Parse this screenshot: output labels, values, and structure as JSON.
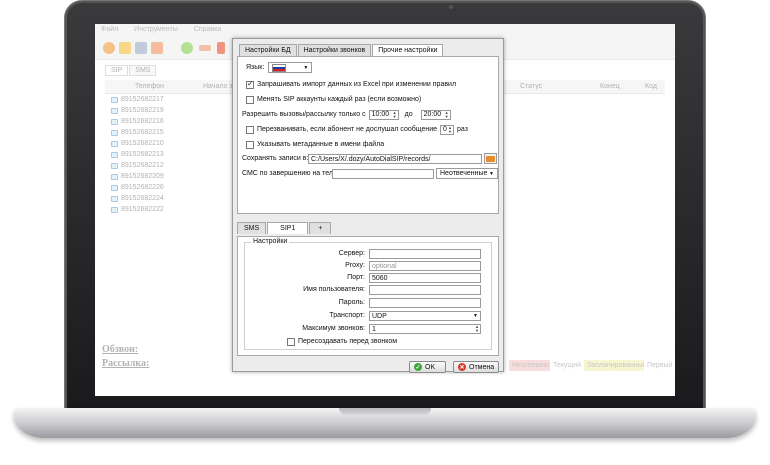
{
  "menu": [
    "Файл",
    "Инструменты",
    "Справка"
  ],
  "main": {
    "tabs": [
      "SIP",
      "SMS"
    ],
    "columns": [
      "Телефон",
      "Начало з",
      "Статус",
      "Конец",
      "Код"
    ],
    "phones": [
      "89152682217",
      "89152682219",
      "89152682216",
      "89152682215",
      "89152682210",
      "89152682213",
      "89152682212",
      "89152682209",
      "89152682226",
      "89152682224",
      "89152682222"
    ],
    "obzvon": "Обзвон:",
    "rassylka": "Рассылка:",
    "legend": [
      {
        "label": "Неуспешно",
        "color": "#f6c9c9"
      },
      {
        "label": "Текущий",
        "color": "#ffffff"
      },
      {
        "label": "Запланированный",
        "color": "#f4f1b8"
      },
      {
        "label": "Первый",
        "color": "#ffffff"
      }
    ]
  },
  "dialog": {
    "tabs": [
      "Настройки БД",
      "Настройки звонков",
      "Прочие настройки"
    ],
    "language_label": "Язык:",
    "import_excel": "Запрашивать импорт данных из Excel при изменении правил",
    "import_excel_checked": true,
    "change_sip": "Менять SIP аккаунты каждый раз (если возможно)",
    "change_sip_checked": false,
    "allow_calls_label": "Разрешить вызовы/рассылку только с",
    "time_from": "10:00",
    "time_to_label": "до",
    "time_to": "20:00",
    "recall_label": "Перезванивать, если абонент не дослушал сообщение",
    "recall_count": "0",
    "recall_suffix": "раз",
    "metadata_label": "Указывать метаданные в имени файла",
    "save_records_label": "Сохранять записи в:",
    "save_records_path": "C:/Users/X/.dozy/AutoDialSIP/records/",
    "sms_label": "СМС по завершению на тел:",
    "sms_value": "",
    "sms_select": "Неотвеченные",
    "sub_tabs": [
      "SMS",
      "SIP1",
      "+"
    ],
    "group_title": "Настройки",
    "fields": [
      {
        "label": "Сервер:",
        "value": "",
        "placeholder": ""
      },
      {
        "label": "Proxy:",
        "value": "",
        "placeholder": "optional"
      },
      {
        "label": "Порт:",
        "value": "5060",
        "placeholder": ""
      },
      {
        "label": "Имя пользователя:",
        "value": "",
        "placeholder": ""
      },
      {
        "label": "Пароль:",
        "value": "",
        "placeholder": ""
      }
    ],
    "transport_label": "Транспорт:",
    "transport_value": "UDP",
    "max_calls_label": "Максимум звонков:",
    "max_calls_value": "1",
    "recreate_label": "Пересоздавать перед звонком",
    "recreate_checked": false,
    "ok_label": "OK",
    "cancel_label": "Отмена"
  }
}
